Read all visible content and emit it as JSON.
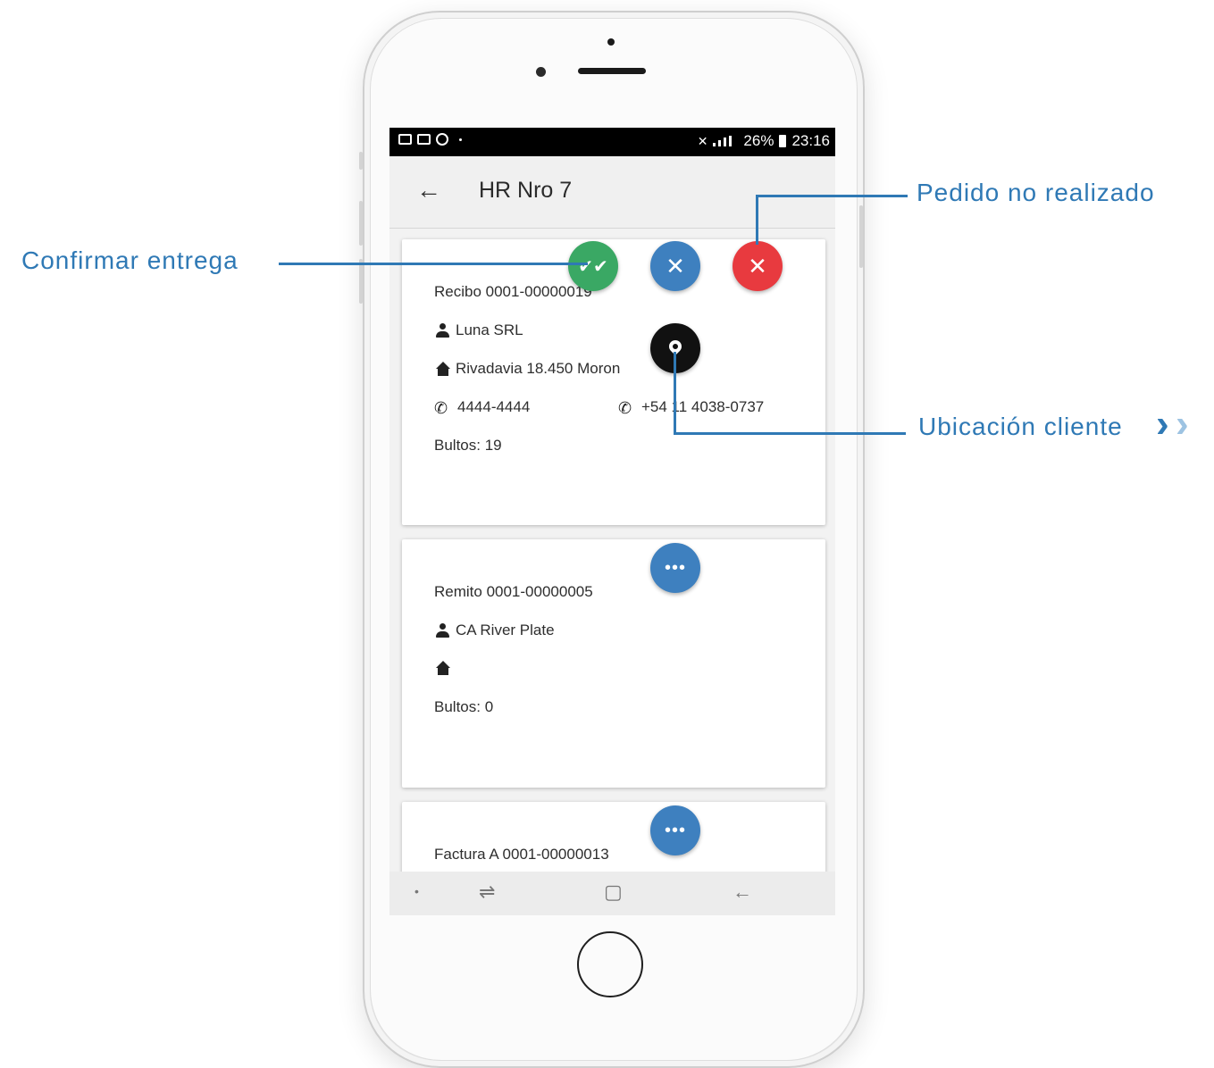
{
  "statusbar": {
    "battery": "26%",
    "time": "23:16"
  },
  "appbar": {
    "back_icon": "arrow-left-icon",
    "title": "HR Nro 7"
  },
  "cards": [
    {
      "doc": "Recibo 0001-00000019",
      "client": "Luna SRL",
      "address": "Rivadavia 18.450 Moron",
      "phone1": "4444-4444",
      "phone2": "+54 11 4038-0737",
      "bultos": "Bultos: 19",
      "actions": [
        "confirm-delivery",
        "cancel",
        "not-done",
        "location"
      ]
    },
    {
      "doc": "Remito 0001-00000005",
      "client": "CA River Plate",
      "address": "",
      "bultos": "Bultos: 0",
      "actions": [
        "more"
      ]
    },
    {
      "doc": "Factura A 0001-00000013",
      "actions": [
        "more"
      ]
    }
  ],
  "annotations": {
    "confirm": "Confirmar entrega",
    "not_done": "Pedido no realizado",
    "location": "Ubicación cliente"
  },
  "colors": {
    "accent": "#2f79b5",
    "green": "#3aa864",
    "blue": "#3e80bf",
    "red": "#e83a3f"
  }
}
